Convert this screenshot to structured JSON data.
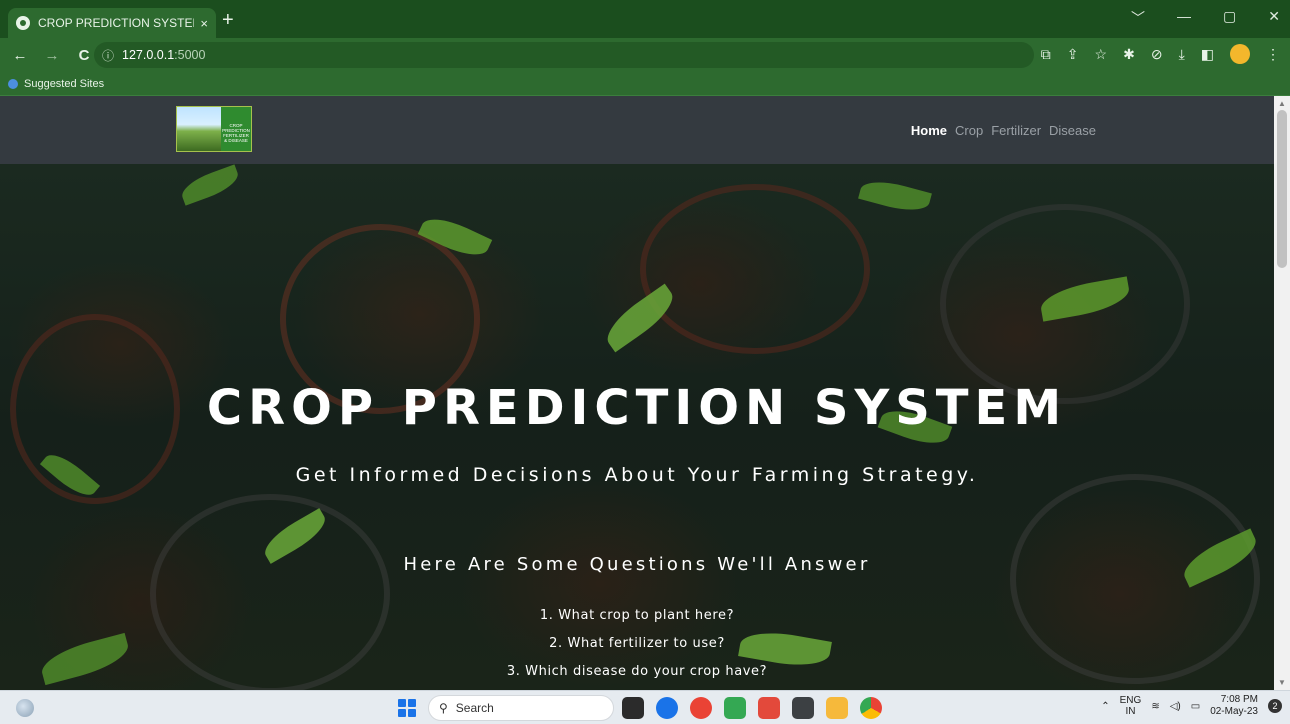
{
  "browser": {
    "tab_title": "CROP PREDICTION SYSTEM - Ho",
    "tab_close": "×",
    "new_tab": "+",
    "window_controls": [
      "﹀",
      "—",
      "▢",
      "✕"
    ],
    "nav": {
      "back": "←",
      "forward": "→",
      "reload": "C"
    },
    "url_info_icon": "ⓘ",
    "url_host": "127.0.0.1",
    "url_port": ":5000",
    "toolbar_icons": [
      "translate-icon",
      "share-icon",
      "star-icon",
      "extensions-icon",
      "history-icon",
      "download-icon",
      "sidepanel-icon",
      "profile-icon",
      "menu-icon"
    ],
    "bookmark_label": "Suggested Sites"
  },
  "site": {
    "logo_text": "CROP PREDICTION FERTILIZER & DISEASE",
    "menu": [
      "Home",
      "Crop",
      "Fertilizer",
      "Disease"
    ],
    "active_menu": "Home",
    "hero_title": "CROP PREDICTION SYSTEM",
    "hero_subtitle": "Get Informed Decisions About Your Farming Strategy.",
    "questions_heading": "Here Are Some Questions We'll Answer",
    "questions": [
      "1. What crop to plant here?",
      "2. What fertilizer to use?",
      "3. Which disease do your crop have?"
    ]
  },
  "taskbar": {
    "search_placeholder": "Search",
    "lang_top": "ENG",
    "lang_bottom": "IN",
    "time": "7:08 PM",
    "date": "02-May-23",
    "notification_count": "2",
    "app_colors": [
      "#2b2b2b",
      "#1a73e8",
      "#ea4335",
      "#34a853",
      "#e3493b",
      "#3c4043",
      "#f6b93b",
      "#fbbc05"
    ]
  }
}
